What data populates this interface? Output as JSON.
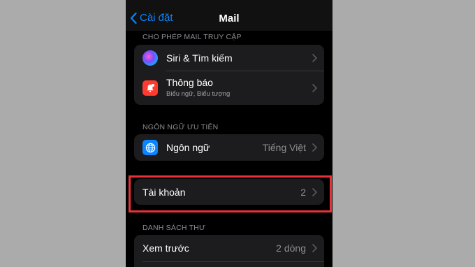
{
  "nav": {
    "back_label": "Cài đặt",
    "title": "Mail"
  },
  "sections": {
    "access_header": "CHO PHÉP MAIL TRUY CẬP",
    "language_header": "NGÔN NGỮ ƯU TIÊN",
    "list_header": "DANH SÁCH THƯ"
  },
  "rows": {
    "siri": {
      "label": "Siri & Tìm kiếm",
      "icon": "siri-icon"
    },
    "notifications": {
      "label": "Thông báo",
      "sublabel": "Biểu ngữ, Biểu tượng",
      "icon": "bell-badge-icon"
    },
    "language": {
      "label": "Ngôn ngữ",
      "value": "Tiếng Việt",
      "icon": "globe-icon"
    },
    "accounts": {
      "label": "Tài khoản",
      "value": "2"
    },
    "preview": {
      "label": "Xem trước",
      "value": "2 dòng"
    }
  },
  "colors": {
    "accent": "#0a84ff",
    "highlight": "#e8323a",
    "notification_icon": "#ff3b30",
    "language_icon": "#0a84ff"
  }
}
